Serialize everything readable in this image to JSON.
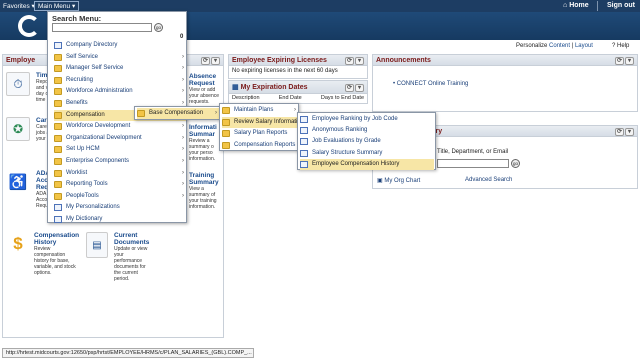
{
  "topbar": {
    "favorites": "Favorites",
    "main_menu": "Main Menu",
    "home": "Home",
    "sign_out": "Sign out"
  },
  "personalize": {
    "prefix": "Personalize",
    "content": "Content",
    "sep": "|",
    "layout": "Layout",
    "help": "Help"
  },
  "menu": {
    "header": "Search Menu:",
    "go_label": "go",
    "count": "0",
    "items": [
      {
        "label": "Company Directory",
        "icon": "doc",
        "arrow": false
      },
      {
        "label": "Self Service",
        "icon": "folder",
        "arrow": true
      },
      {
        "label": "Manager Self Service",
        "icon": "folder",
        "arrow": true
      },
      {
        "label": "Recruiting",
        "icon": "folder",
        "arrow": true
      },
      {
        "label": "Workforce Administration",
        "icon": "folder",
        "arrow": true
      },
      {
        "label": "Benefits",
        "icon": "folder",
        "arrow": true
      },
      {
        "label": "Compensation",
        "icon": "folder",
        "arrow": true
      },
      {
        "label": "Workforce Development",
        "icon": "folder",
        "arrow": true
      },
      {
        "label": "Organizational Development",
        "icon": "folder",
        "arrow": true
      },
      {
        "label": "Set Up HCM",
        "icon": "folder",
        "arrow": true
      },
      {
        "label": "Enterprise Components",
        "icon": "folder",
        "arrow": true
      },
      {
        "label": "Worklist",
        "icon": "folder",
        "arrow": true
      },
      {
        "label": "Reporting Tools",
        "icon": "folder",
        "arrow": true
      },
      {
        "label": "PeopleTools",
        "icon": "folder",
        "arrow": true
      },
      {
        "label": "My Personalizations",
        "icon": "doc",
        "arrow": false
      },
      {
        "label": "My Dictionary",
        "icon": "doc",
        "arrow": false
      }
    ]
  },
  "submenu1": {
    "label": "Base Compensation"
  },
  "submenu2": {
    "items": [
      {
        "label": "Maintain Plans",
        "arrow": true
      },
      {
        "label": "Review Salary Informati",
        "arrow": true
      },
      {
        "label": "Salary Plan Reports",
        "arrow": false
      },
      {
        "label": "Compensation Reports",
        "arrow": false
      }
    ]
  },
  "submenu3": {
    "items": [
      "Employee Ranking by Job Code",
      "Anonymous Ranking",
      "Job Evaluations by Grade",
      "Salary Structure Summary",
      "Employee Compensation History"
    ]
  },
  "panels": {
    "employee": {
      "title": "Employe"
    },
    "expiring": {
      "title": "Employee Expiring Licenses",
      "body": "No expiring licenses in the next 60 days"
    },
    "expiration": {
      "title": "My Expiration Dates",
      "cols": [
        "Description",
        "End Date",
        "Days to End Date"
      ]
    },
    "announcements": {
      "title": "Announcements",
      "link": "CONNECT Online Training"
    },
    "directory": {
      "title": "ctory",
      "hint": "Title, Department, or Email",
      "org_chart": "My Org Chart",
      "advanced": "Advanced Search"
    }
  },
  "tiles": {
    "time": {
      "title": "Time",
      "desc": "Report\nand vi\nday o\ntime p"
    },
    "career": {
      "title": "Care",
      "desc": "Caree\njobs a\nyour c"
    },
    "ada": {
      "title": "ADA\nAccom\nReque",
      "desc": "ADA\nAccor\nReque"
    },
    "absence": {
      "title": "Absence\nRequest",
      "desc": "View or add\nyour absence\nrequests."
    },
    "info_summary": {
      "title": "Informati\nSummar",
      "desc": "Review a\nsummary o\nyour perso\ninformation."
    },
    "training": {
      "title": "Training\nSummary",
      "desc": "View a\nsummary of\nyour training\ninformation."
    },
    "comp_history": {
      "title": "Compensation\nHistory",
      "desc": "Review\ncompensation\nhistory for base,\nvariable, and stock\noptions."
    },
    "current_docs": {
      "title": "Current\nDocuments",
      "desc": "Update or view\nyour\nperformance\ndocuments for\nthe current\nperiod."
    }
  },
  "status": {
    "url": "http://hrtest.midcourts.gov:12650/psp/hrtst/EMPLOYEE/HRMS/c/PLAN_SALARIES_(GBL).COMP_..."
  }
}
